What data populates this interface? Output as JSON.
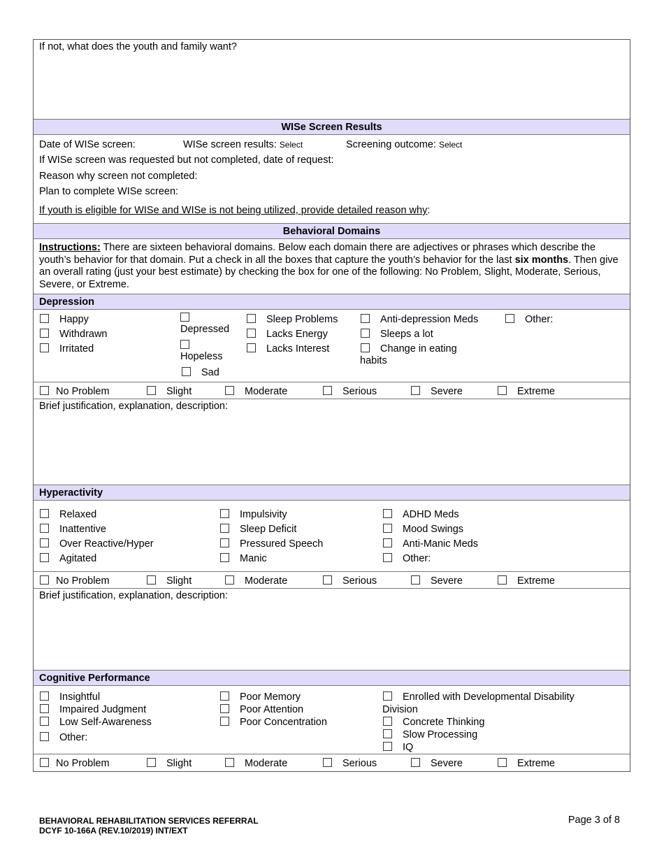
{
  "top_question": {
    "label": "If not, what does the youth and family want?"
  },
  "wise_screen": {
    "header": "WISe Screen Results",
    "date_label": "Date of WISe screen:",
    "results_label": "WISe screen results:",
    "results_value": "Select",
    "outcome_label": "Screening outcome:",
    "outcome_value": "Select",
    "requested_label": "If WISe screen was requested but not completed, date of request:",
    "reason_label": "Reason why screen not completed:",
    "plan_label": "Plan to complete WISe screen:",
    "eligible_label": "If youth is eligible for WISe and WISe is not being utilized, provide detailed reason why",
    "eligible_colon": ":"
  },
  "behavioral_domains": {
    "header": "Behavioral Domains",
    "instructions_label": "Instructions:",
    "instructions_part1": " There are sixteen behavioral domains.  Below each domain there are adjectives or phrases which describe the youth’s behavior for that domain.  Put a check in all the boxes that capture the youth’s behavior for the last ",
    "instructions_bold": "six months",
    "instructions_part2": ".  Then give an overall rating (just your best estimate) by checking the box for one of the following:  No Problem, Slight, Moderate, Serious, Severe, or Extreme."
  },
  "ratings": [
    "No Problem",
    "Slight",
    "Moderate",
    "Serious",
    "Severe",
    "Extreme"
  ],
  "justification_label": "Brief justification, explanation, description:",
  "depression": {
    "header": "Depression",
    "col1": [
      "Happy",
      "Withdrawn",
      "Irritated"
    ],
    "col2": [
      "Depressed",
      "Hopeless",
      "Sad"
    ],
    "col3": [
      "Sleep Problems",
      "Lacks Energy",
      "Lacks Interest"
    ],
    "col4": [
      "Anti-depression Meds",
      "Sleeps a lot",
      "Change in eating",
      "habits"
    ],
    "col5": [
      "Other:"
    ]
  },
  "hyperactivity": {
    "header": "Hyperactivity",
    "col1": [
      "Relaxed",
      "Inattentive",
      "Over Reactive/Hyper",
      "Agitated"
    ],
    "col2": [
      "Impulsivity",
      "Sleep Deficit",
      "Pressured Speech",
      "Manic"
    ],
    "col3": [
      "ADHD Meds",
      "Mood Swings",
      "Anti-Manic Meds",
      "Other:"
    ]
  },
  "cognitive": {
    "header": "Cognitive Performance",
    "col1": [
      "Insightful",
      "Impaired Judgment",
      "Low Self-Awareness",
      "Other:"
    ],
    "col2": [
      "Poor Memory",
      "Poor Attention",
      "Poor Concentration"
    ],
    "col3": [
      "Enrolled with Developmental Disability",
      "Division",
      "Concrete Thinking",
      "Slow Processing",
      "IQ"
    ]
  },
  "footer": {
    "title": "BEHAVIORAL REHABILITATION SERVICES REFERRAL",
    "form_id": "DCYF 10-166A (REV.10/2019) INT/EXT",
    "page": "Page 3 of 8"
  }
}
